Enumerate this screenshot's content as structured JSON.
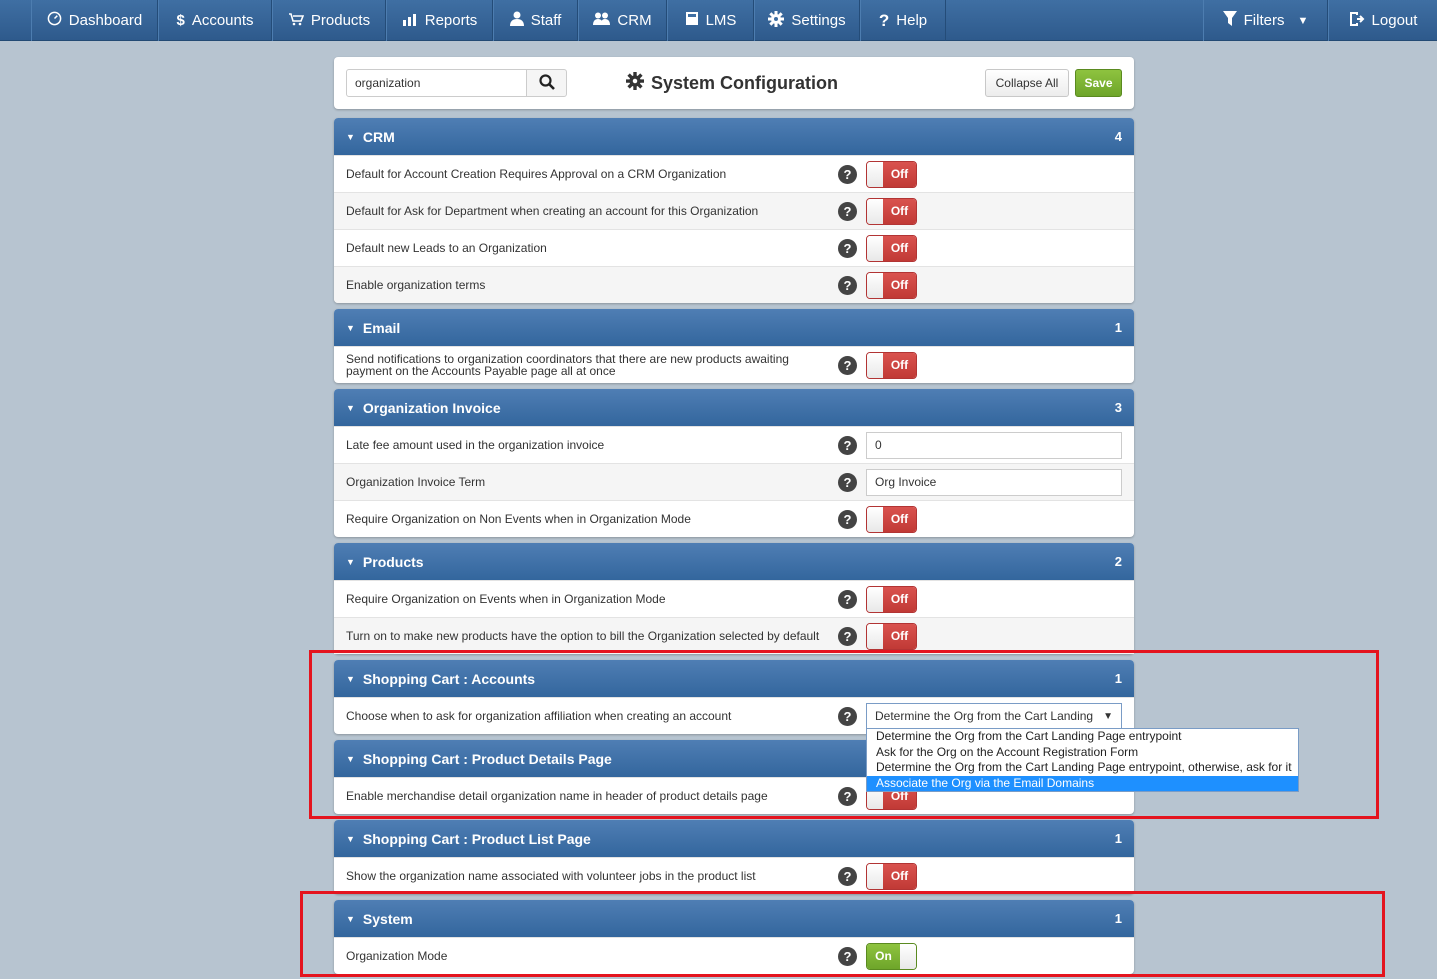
{
  "nav": {
    "items": [
      {
        "label": "Dashboard",
        "icon": "dashboard-icon"
      },
      {
        "label": "Accounts",
        "icon": "dollar-icon"
      },
      {
        "label": "Products",
        "icon": "cart-icon"
      },
      {
        "label": "Reports",
        "icon": "chart-icon"
      },
      {
        "label": "Staff",
        "icon": "user-icon"
      },
      {
        "label": "CRM",
        "icon": "users-icon"
      },
      {
        "label": "LMS",
        "icon": "book-icon"
      },
      {
        "label": "Settings",
        "icon": "gear-icon"
      },
      {
        "label": "Help",
        "icon": "question-icon"
      }
    ],
    "filters": "Filters",
    "logout": "Logout"
  },
  "toolbar": {
    "search_value": "organization",
    "title": "System Configuration",
    "collapse_label": "Collapse All",
    "save_label": "Save"
  },
  "sections": [
    {
      "title": "CRM",
      "count": "4",
      "rows": [
        {
          "label": "Default for Account Creation Requires Approval on a CRM Organization",
          "control": "toggle",
          "value": "Off"
        },
        {
          "label": "Default for Ask for Department when creating an account for this Organization",
          "control": "toggle",
          "value": "Off"
        },
        {
          "label": "Default new Leads to an Organization",
          "control": "toggle",
          "value": "Off"
        },
        {
          "label": "Enable organization terms",
          "control": "toggle",
          "value": "Off"
        }
      ]
    },
    {
      "title": "Email",
      "count": "1",
      "rows": [
        {
          "label": "Send notifications to organization coordinators that there are new products awaiting payment on the Accounts Payable page all at once",
          "control": "toggle",
          "value": "Off"
        }
      ]
    },
    {
      "title": "Organization Invoice",
      "count": "3",
      "rows": [
        {
          "label": "Late fee amount used in the organization invoice",
          "control": "text",
          "value": "0"
        },
        {
          "label": "Organization Invoice Term",
          "control": "text",
          "value": "Org Invoice"
        },
        {
          "label": "Require Organization on Non Events when in Organization Mode",
          "control": "toggle",
          "value": "Off"
        }
      ]
    },
    {
      "title": "Products",
      "count": "2",
      "rows": [
        {
          "label": "Require Organization on Events when in Organization Mode",
          "control": "toggle",
          "value": "Off"
        },
        {
          "label": "Turn on to make new products have the option to bill the Organization selected by default",
          "control": "toggle",
          "value": "Off"
        }
      ]
    },
    {
      "title": "Shopping Cart : Accounts",
      "count": "1",
      "rows": [
        {
          "label": "Choose when to ask for organization affiliation when creating an account",
          "control": "select",
          "value": "Determine the Org from the Cart Landing"
        }
      ]
    },
    {
      "title": "Shopping Cart : Product Details Page",
      "count": "",
      "rows": [
        {
          "label": "Enable merchandise detail organization name in header of product details page",
          "control": "toggle",
          "value": "Off"
        }
      ]
    },
    {
      "title": "Shopping Cart : Product List Page",
      "count": "1",
      "rows": [
        {
          "label": "Show the organization name associated with volunteer jobs in the product list",
          "control": "toggle",
          "value": "Off"
        }
      ]
    },
    {
      "title": "System",
      "count": "1",
      "rows": [
        {
          "label": "Organization Mode",
          "control": "toggle",
          "value": "On"
        }
      ]
    }
  ],
  "dropdown": {
    "options": [
      "Determine the Org from the Cart Landing Page entrypoint",
      "Ask for the Org on the Account Registration Form",
      "Determine the Org from the Cart Landing Page entrypoint, otherwise, ask for it",
      "Associate the Org via the Email Domains"
    ],
    "selected_index": 3
  },
  "colors": {
    "header_blue": "#3f6fa3",
    "off_red": "#d9534f",
    "on_green": "#7db53a",
    "highlight": "#e4141e"
  }
}
